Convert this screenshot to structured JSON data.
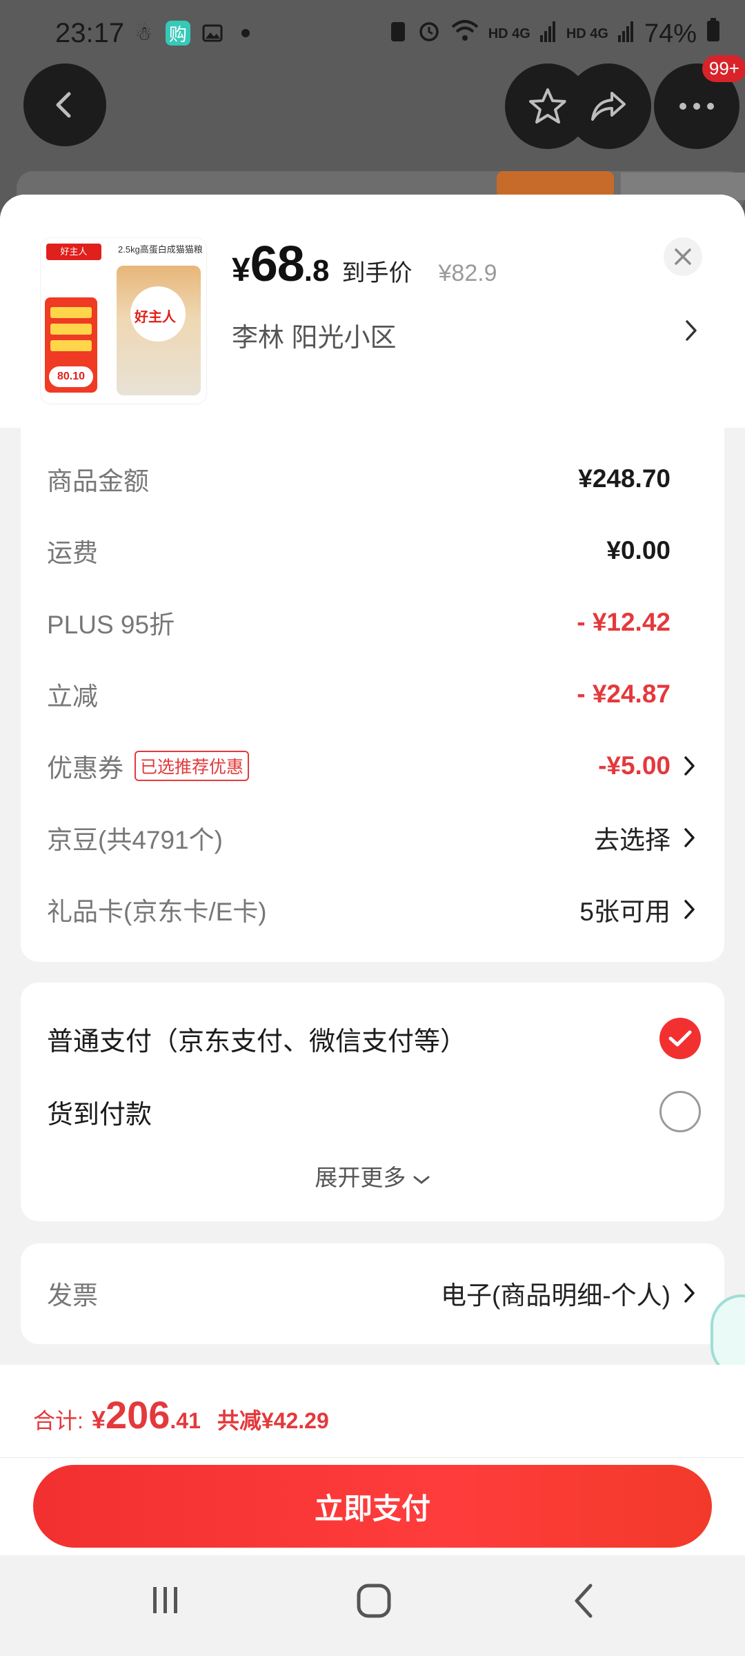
{
  "status_bar": {
    "time": "23:17",
    "network_1": "HD 4G",
    "network_2": "HD 4G",
    "battery": "74%"
  },
  "header": {
    "back_icon": "back-arrow-icon",
    "favorite_icon": "star-icon",
    "share_icon": "share-icon",
    "more_icon": "more-dots-icon",
    "more_badge": "99+"
  },
  "product": {
    "price_currency": "¥",
    "price_integer": "68",
    "price_decimal": ".8",
    "price_label": "到手价",
    "original_price": "¥82.9",
    "image_title": "2.5kg高蛋白成猫猫粮",
    "image_brand": "好主人",
    "image_price": "80.10"
  },
  "address": {
    "text": "李林  阳光小区"
  },
  "summary": {
    "rows": [
      {
        "label": "商品金额",
        "value": "¥248.70"
      },
      {
        "label": "运费",
        "value": "¥0.00"
      },
      {
        "label": "PLUS 95折",
        "value": "- ¥12.42"
      },
      {
        "label": "立减",
        "value": "- ¥24.87"
      },
      {
        "label": "优惠券",
        "tag": "已选推荐优惠",
        "value": "-¥5.00"
      },
      {
        "label": "京豆(共4791个)",
        "value": "去选择"
      },
      {
        "label": "礼品卡(京东卡/E卡)",
        "value": "5张可用"
      }
    ]
  },
  "payment": {
    "option_1": "普通支付（京东支付、微信支付等）",
    "option_2": "货到付款",
    "selected": "option_1",
    "expand_label": "展开更多"
  },
  "invoice": {
    "label": "发票",
    "value": "电子(商品明细-个人)"
  },
  "total": {
    "label": "合计:",
    "currency": "¥",
    "integer": "206",
    "decimal": ".41",
    "savings": "共减¥42.29"
  },
  "pay_button": "立即支付",
  "colors": {
    "accent": "#f23030",
    "price_red": "#e4393c"
  }
}
